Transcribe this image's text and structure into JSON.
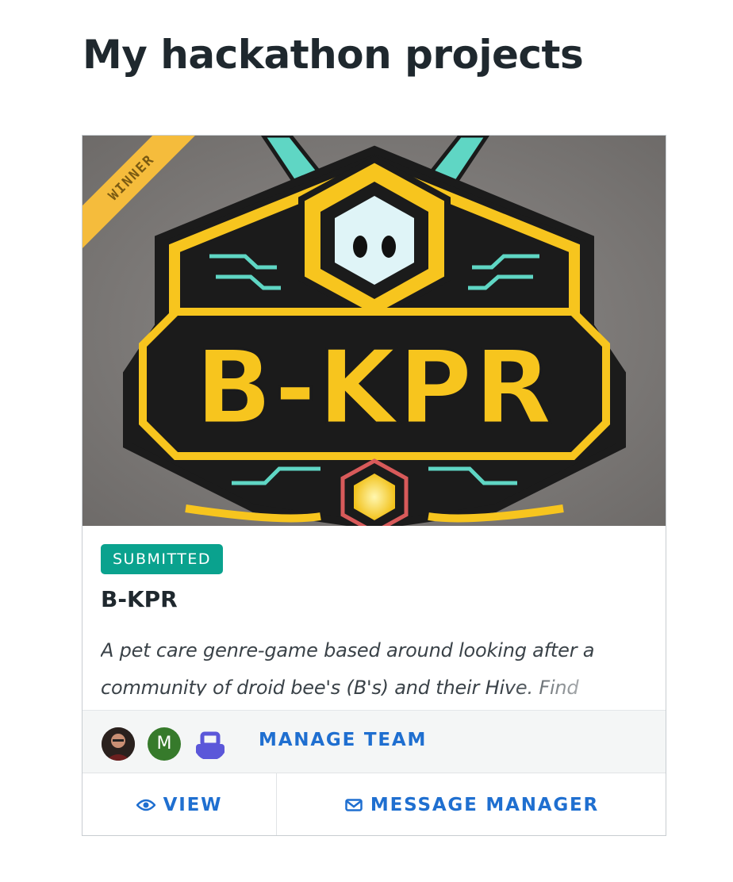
{
  "page": {
    "title": "My hackathon projects"
  },
  "project": {
    "ribbon": "WINNER",
    "logo_text": "B-KPR",
    "status": "SUBMITTED",
    "title": "B-KPR",
    "description": "A pet care genre-game based around looking after a community of droid bee's (B's) and their Hive. Find",
    "team": {
      "member_initial": "M",
      "manage_label": "MANAGE TEAM"
    },
    "actions": {
      "view_label": "VIEW",
      "message_label": "MESSAGE MANAGER"
    }
  },
  "colors": {
    "accent": "#1f6fd0",
    "status": "#0aa28e",
    "ribbon": "#f5bc3c",
    "logo_yellow": "#f7c51e",
    "logo_teal": "#5fd6c4"
  },
  "icons": [
    "eye-icon",
    "envelope-icon",
    "robot-avatar-icon"
  ]
}
